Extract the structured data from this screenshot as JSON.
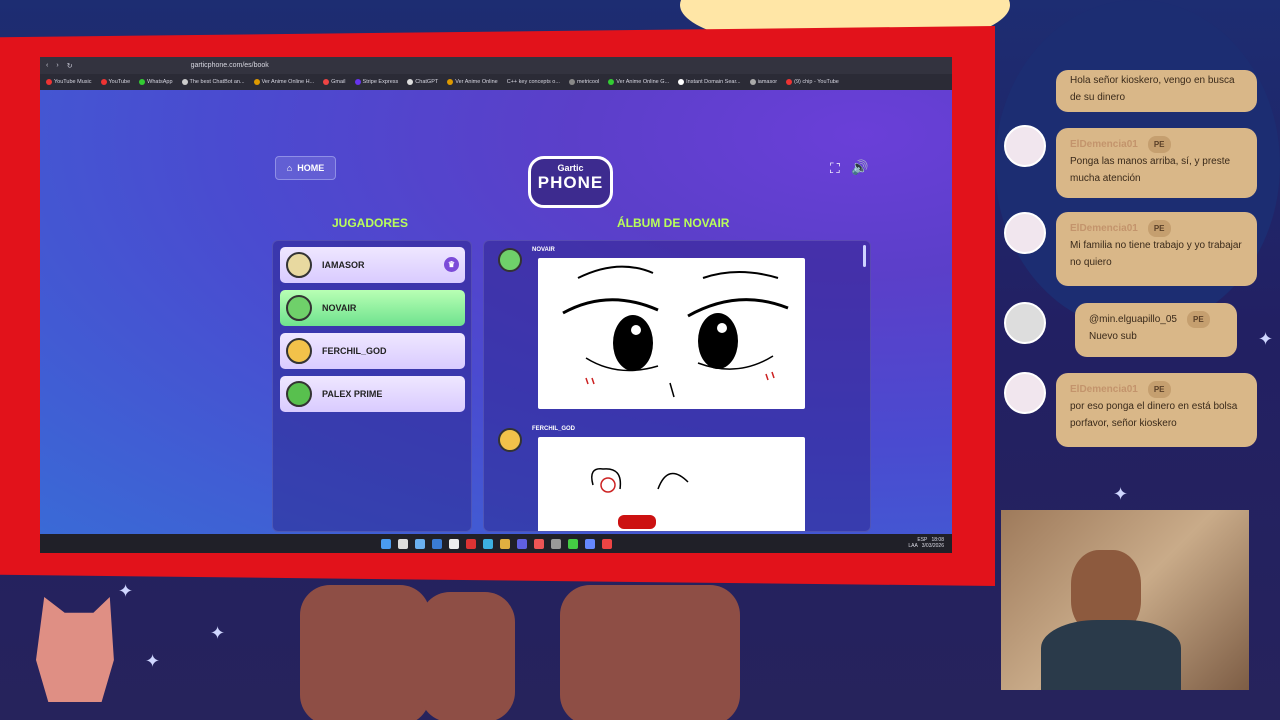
{
  "browser": {
    "url": "garticphone.com/es/book",
    "bookmarks": [
      "YouTube Music",
      "YouTube",
      "WhatsApp",
      "The best ChatBot an...",
      "Ver Anime Online H...",
      "Gmail",
      "Stripe Express",
      "ChatGPT",
      "Ver Anime Online",
      "C++ key concepts o...",
      "metricool",
      "Ver Anime Online G...",
      "Instant Domain Sear...",
      "iamasor",
      "(9) chip - YouTube"
    ]
  },
  "gartic": {
    "home_label": "HOME",
    "logo_top": "Gartic",
    "logo_bottom": "PHONE",
    "players_title": "JUGADORES",
    "album_title": "ÁLBUM DE NOVAIR",
    "players": [
      {
        "name": "IAMASOR",
        "selected": false,
        "host": true,
        "avatar_color": "#e8d9a0"
      },
      {
        "name": "NOVAIR",
        "selected": true,
        "host": false,
        "avatar_color": "#6fd06a"
      },
      {
        "name": "FERCHIL_GOD",
        "selected": false,
        "host": false,
        "avatar_color": "#f2c24a"
      },
      {
        "name": "PALEX PRIME",
        "selected": false,
        "host": false,
        "avatar_color": "#58c04e"
      }
    ],
    "album_entries": [
      {
        "author": "NOVAIR"
      },
      {
        "author": "FERCHIL_GOD"
      }
    ]
  },
  "taskbar": {
    "lang": "ESP",
    "lang2": "LAA",
    "time": "18:08",
    "date": "3/03/2026"
  },
  "chat": [
    {
      "user": "",
      "text": "Hola señor kioskero, vengo en busca de su dinero"
    },
    {
      "user": "ElDemencia01",
      "badge": "PE",
      "text": "Ponga las manos arriba, sí, y preste mucha atención"
    },
    {
      "user": "ElDemencia01",
      "badge": "PE",
      "text": "Mi familia no tiene trabajo y yo trabajar no quiero"
    },
    {
      "user": "@min.elguapillo_05",
      "badge": "PE",
      "text": "Nuevo sub"
    },
    {
      "user": "ElDemencia01",
      "badge": "PE",
      "text": "por eso ponga el dinero en está bolsa porfavor, señor kioskero"
    }
  ]
}
